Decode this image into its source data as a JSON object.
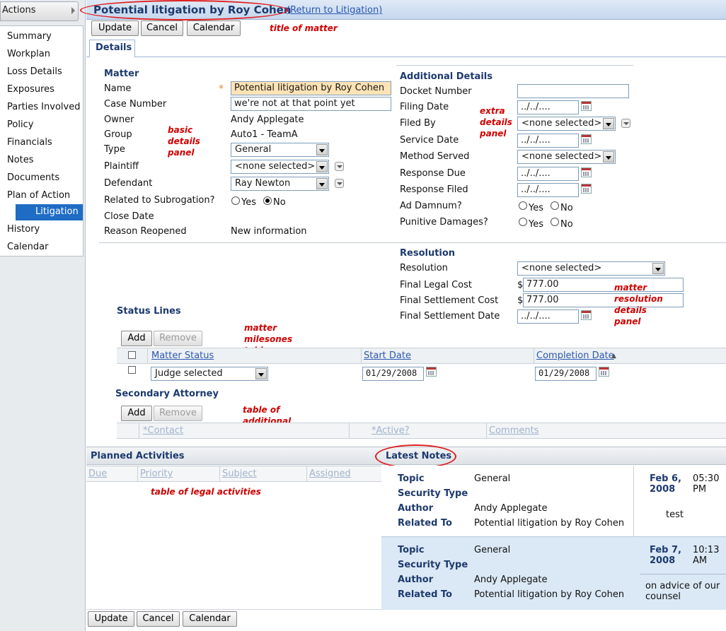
{
  "sidebar": {
    "actions_label": "Actions",
    "items": [
      "Summary",
      "Workplan",
      "Loss Details",
      "Exposures",
      "Parties Involved",
      "Policy",
      "Financials",
      "Notes",
      "Documents",
      "Plan of Action",
      "Litigation",
      "History",
      "Calendar"
    ],
    "selected": "Litigation"
  },
  "header": {
    "title": "Potential litigation by Roy Cohen",
    "return_link": "(Return to Litigation)"
  },
  "toolbar": {
    "update": "Update",
    "cancel": "Cancel",
    "calendar": "Calendar"
  },
  "tabs": [
    "Details"
  ],
  "matter": {
    "section_title": "Matter",
    "required_mark": "*",
    "name_label": "Name",
    "name_value": "Potential litigation by Roy Cohen",
    "case_label": "Case Number",
    "case_value": "we're not at that point yet",
    "owner_label": "Owner",
    "owner_value": "Andy Applegate",
    "group_label": "Group",
    "group_value": "Auto1 - TeamA",
    "type_label": "Type",
    "type_value": "General",
    "plaintiff_label": "Plaintiff",
    "plaintiff_value": "<none selected>",
    "defendant_label": "Defendant",
    "defendant_value": "Ray Newton",
    "subro_label": "Related to Subrogation?",
    "yes": "Yes",
    "no": "No",
    "subro_selected": "No",
    "close_label": "Close Date",
    "reopened_label": "Reason Reopened",
    "reopened_value": "New information"
  },
  "additional": {
    "section_title": "Additional Details",
    "docket_label": "Docket Number",
    "docket_value": "",
    "filing_label": "Filing Date",
    "filing_value": "../../....",
    "filedby_label": "Filed By",
    "filedby_value": "<none selected>",
    "service_label": "Service Date",
    "service_value": "../../....",
    "method_label": "Method Served",
    "method_value": "<none selected>",
    "respdue_label": "Response Due",
    "respdue_value": "../../....",
    "respfiled_label": "Response Filed",
    "respfiled_value": "../../....",
    "addamnum_label": "Ad Damnum?",
    "punitive_label": "Punitive Damages?",
    "yes": "Yes",
    "no": "No"
  },
  "resolution": {
    "section_title": "Resolution",
    "resolution_label": "Resolution",
    "resolution_value": "<none selected>",
    "legal_label": "Final Legal Cost",
    "legal_value": "777.00",
    "settlement_label": "Final Settlement Cost",
    "settlement_value": "777.00",
    "currency": "$",
    "settdate_label": "Final Settlement Date",
    "settdate_value": "../../...."
  },
  "status_lines": {
    "title": "Status Lines",
    "add": "Add",
    "remove": "Remove",
    "columns": [
      "Matter Status",
      "Start Date",
      "Completion Date"
    ],
    "sort_indicator": "▲",
    "rows": [
      {
        "status": "Judge selected",
        "start": "01/29/2008",
        "completion": "01/29/2008"
      }
    ]
  },
  "secondary_attorney": {
    "title": "Secondary Attorney",
    "add": "Add",
    "remove": "Remove",
    "columns": [
      "*Contact",
      "*Active?",
      "Comments"
    ]
  },
  "planned_activities": {
    "title": "Planned Activities",
    "columns": [
      "Due",
      "Priority",
      "Subject",
      "Assigned"
    ]
  },
  "latest_notes": {
    "title": "Latest Notes",
    "labels": {
      "topic": "Topic",
      "security": "Security Type",
      "author": "Author",
      "related": "Related To"
    },
    "notes": [
      {
        "topic": "General",
        "security": "",
        "author": "Andy Applegate",
        "related": "Potential litigation by Roy Cohen",
        "date": "Feb 6, 2008",
        "time": "05:30 PM",
        "body": "test"
      },
      {
        "topic": "General",
        "security": "",
        "author": "Andy Applegate",
        "related": "Potential litigation by Roy Cohen",
        "date": "Feb 7, 2008",
        "time": "10:13 AM",
        "body": "on advice of our counsel"
      }
    ]
  },
  "annotations": {
    "title_of_matter": "title of matter",
    "basic_details": "basic details panel",
    "extra_details": "extra details panel",
    "milestones": "matter milesones table",
    "resolution": "matter resolution details panel",
    "attornies": "table of additional attornies",
    "activities": "table of legal activities"
  },
  "colors": {
    "accent": "#1f6cc4",
    "annotation": "#d00000",
    "header_bg": "#c6d7ee"
  }
}
